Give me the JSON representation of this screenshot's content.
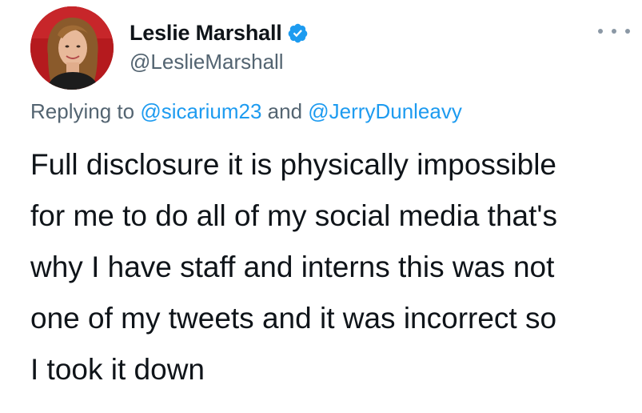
{
  "user": {
    "display_name": "Leslie Marshall",
    "handle": "@LeslieMarshall",
    "verified_icon": "verified-badge-icon",
    "avatar_icon": "profile-photo"
  },
  "more_icon": "more-options-icon",
  "reply": {
    "prefix": "Replying to",
    "mention_1": "@sicarium23",
    "joiner": "and",
    "mention_2": "@JerryDunleavy"
  },
  "tweet": {
    "lines": [
      "Full disclosure it is physically impossible",
      "for me to do all of my social media that's",
      "why I have staff and interns this was not",
      "one of my tweets and it was incorrect so",
      "I took it down"
    ]
  },
  "colors": {
    "link": "#1d9bf0",
    "muted": "#536471",
    "text": "#0f1419",
    "avatar_bg": "#b51a1e"
  }
}
